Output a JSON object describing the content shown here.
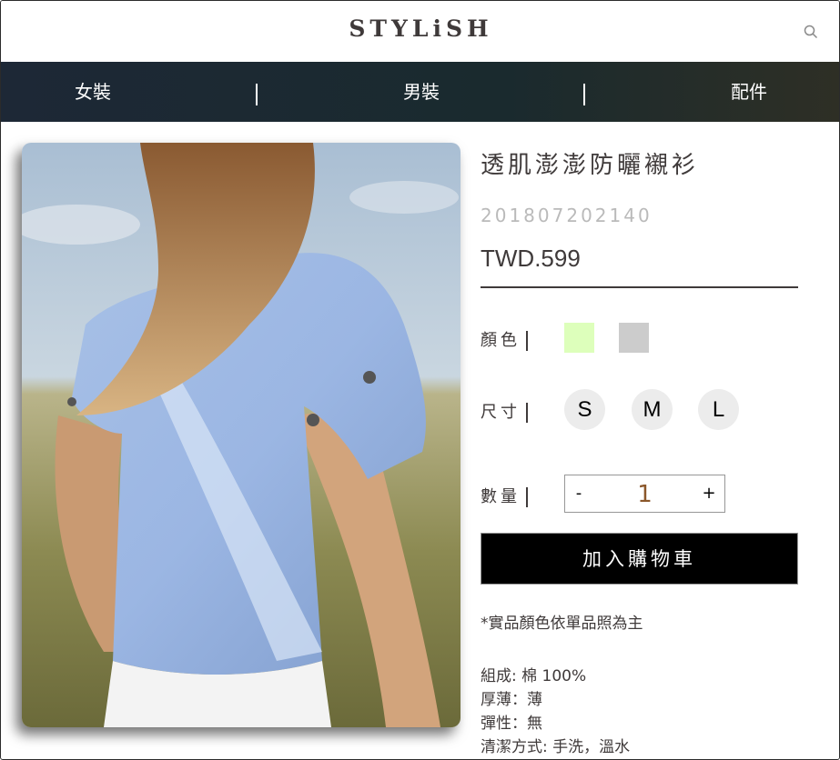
{
  "brand": {
    "logo_text": "STYLiSH"
  },
  "nav": {
    "items": [
      "女裝",
      "男裝",
      "配件"
    ]
  },
  "product": {
    "title": "透肌澎澎防曬襯衫",
    "id": "201807202140",
    "price": "TWD.599",
    "color_label": "顏色",
    "colors": [
      "#DDFFBB",
      "#CCCCCC"
    ],
    "size_label": "尺寸",
    "sizes": [
      "S",
      "M",
      "L"
    ],
    "quantity_label": "數量",
    "quantity": {
      "minus": "-",
      "value": "1",
      "plus": "+"
    },
    "add_to_cart": "加入購物車",
    "note": "*實品顏色依單品照為主",
    "specs": [
      "組成: 棉 100%",
      "厚薄：薄",
      "彈性：無",
      "清潔方式: 手洗，溫水"
    ]
  },
  "icons": {
    "search": "search-icon"
  },
  "colors": {
    "nav_bg": "#1d2836",
    "button_bg": "#000000",
    "qty_value": "#8b572a",
    "text": "#3f3a3a"
  }
}
